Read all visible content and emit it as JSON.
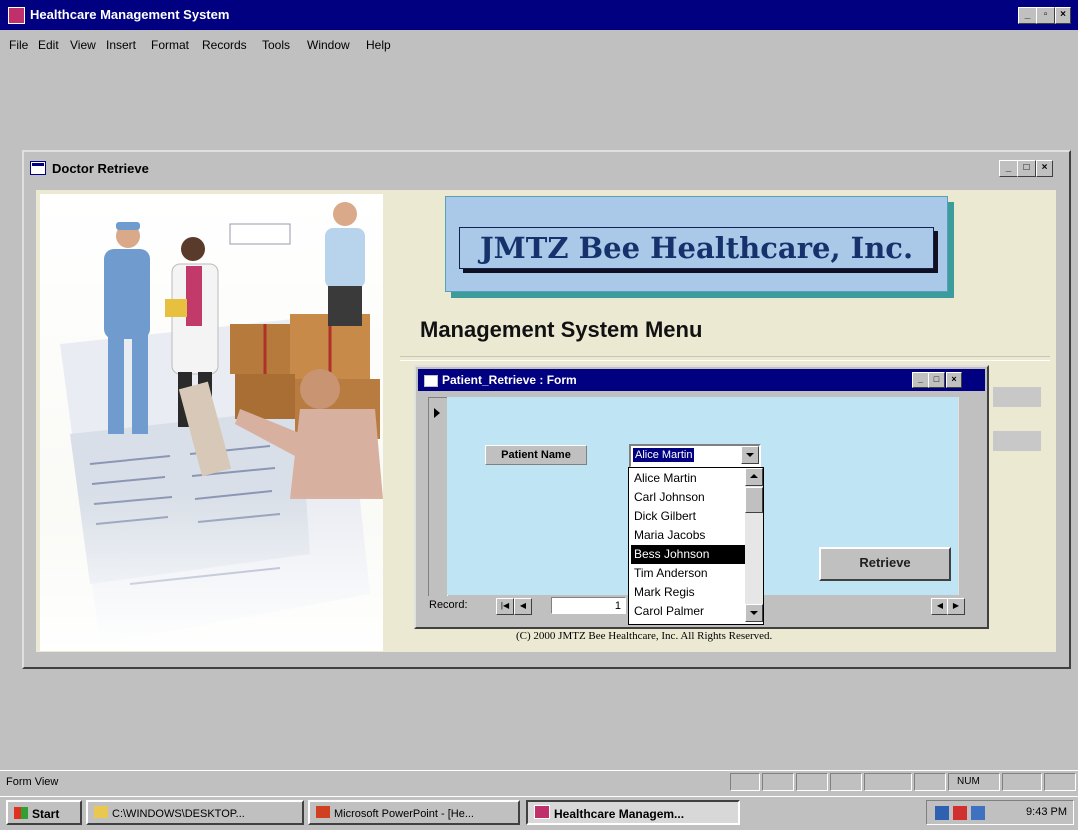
{
  "app": {
    "title": "Healthcare Management System",
    "menu": [
      "File",
      "Edit",
      "View",
      "Insert",
      "Format",
      "Records",
      "Tools",
      "Window",
      "Help"
    ]
  },
  "doctor_window": {
    "title": "Doctor Retrieve",
    "logo_text": "JMTZ Bee Healthcare, Inc.",
    "menu_heading": "Management System Menu",
    "copyright": "(C) 2000 JMTZ Bee Healthcare, Inc. All Rights Reserved."
  },
  "patient_form": {
    "title": "Patient_Retrieve : Form",
    "field_label": "Patient Name",
    "selected_value": "Alice Martin",
    "options": [
      "Alice Martin",
      "Carl Johnson",
      "Dick Gilbert",
      "Maria Jacobs",
      "Bess Johnson",
      "Tim Anderson",
      "Mark Regis",
      "Carol Palmer"
    ],
    "highlighted_option": "Bess Johnson",
    "retrieve_label": "Retrieve",
    "record_label": "Record:",
    "record_number": "1"
  },
  "status": {
    "view": "Form View",
    "num": "NUM"
  },
  "taskbar": {
    "start": "Start",
    "tasks": [
      "C:\\WINDOWS\\DESKTOP...",
      "Microsoft PowerPoint - [He...",
      "Healthcare Managem..."
    ],
    "clock": "9:43 PM"
  },
  "colors": {
    "title_bar": "#000080",
    "form_background": "#ece9d3",
    "form_detail": "#bfe5f5",
    "logo_box": "#aac8e8",
    "logo_text": "#16326c"
  }
}
